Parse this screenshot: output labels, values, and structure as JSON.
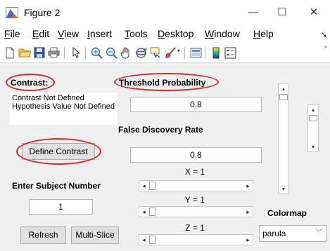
{
  "window": {
    "title": "Figure 2",
    "minimize": "—",
    "maximize": "☐",
    "close": "✕"
  },
  "menu": {
    "file": {
      "u": "F",
      "rest": "ile"
    },
    "edit": {
      "u": "E",
      "rest": "dit"
    },
    "view": {
      "u": "V",
      "rest": "iew"
    },
    "insert": {
      "u": "I",
      "rest": "nsert"
    },
    "tools": {
      "u": "T",
      "rest": "ools"
    },
    "desktop": {
      "u": "D",
      "rest": "esktop"
    },
    "window": {
      "u": "W",
      "rest": "indow"
    },
    "help": {
      "u": "H",
      "rest": "elp"
    }
  },
  "toolbar": {
    "icons": [
      "new-figure-icon",
      "open-file-icon",
      "save-icon",
      "print-icon",
      "pointer-icon",
      "zoom-in-icon",
      "zoom-out-icon",
      "pan-icon",
      "rotate-3d-icon",
      "data-cursor-icon",
      "brush-icon",
      "link-plot-icon",
      "colorbar-icon",
      "legend-icon"
    ]
  },
  "contrast": {
    "label": "Contrast:",
    "text": "Contrast Not Defined Hypothesis Value Not Defined",
    "define_button": "Define Contrast"
  },
  "threshold": {
    "label": "Threshold Probability",
    "value": "0.8"
  },
  "fdr": {
    "label": "False Discovery Rate",
    "value": "0.8"
  },
  "subject": {
    "label": "Enter Subject Number",
    "value": "1"
  },
  "sliders": {
    "x_label": "X = 1",
    "y_label": "Y = 1",
    "z_label": "Z = 1",
    "x_value": 1,
    "y_value": 1,
    "z_value": 1
  },
  "buttons": {
    "refresh": "Refresh",
    "multislice": "Multi-Slice"
  },
  "colormap": {
    "label": "Colormap",
    "selected": "parula"
  },
  "annotation_color": "#d62828"
}
